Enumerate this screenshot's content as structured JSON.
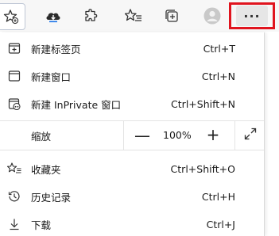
{
  "toolbar": {
    "buttons": [
      {
        "icon": "favorite-add-icon"
      },
      {
        "icon": "cloud-download-icon"
      },
      {
        "icon": "extensions-icon"
      },
      {
        "icon": "favorites-icon"
      },
      {
        "icon": "collections-icon"
      },
      {
        "icon": "profile-avatar-icon"
      }
    ],
    "more_label": "···",
    "highlight_color": "#e0141e"
  },
  "menu": {
    "items": [
      {
        "label": "新建标签页",
        "shortcut": "Ctrl+T",
        "icon": "new-tab-icon"
      },
      {
        "label": "新建窗口",
        "shortcut": "Ctrl+N",
        "icon": "new-window-icon"
      },
      {
        "label": "新建 InPrivate 窗口",
        "shortcut": "Ctrl+Shift+N",
        "icon": "inprivate-window-icon"
      }
    ],
    "zoom": {
      "label": "缩放",
      "decrease": "—",
      "value": "100%",
      "increase": "+",
      "fullscreen_icon": "fullscreen-icon"
    },
    "items2": [
      {
        "label": "收藏夹",
        "shortcut": "Ctrl+Shift+O",
        "icon": "favorites-icon"
      },
      {
        "label": "历史记录",
        "shortcut": "Ctrl+H",
        "icon": "history-icon"
      },
      {
        "label": "下载",
        "shortcut": "Ctrl+J",
        "icon": "download-icon"
      }
    ]
  }
}
